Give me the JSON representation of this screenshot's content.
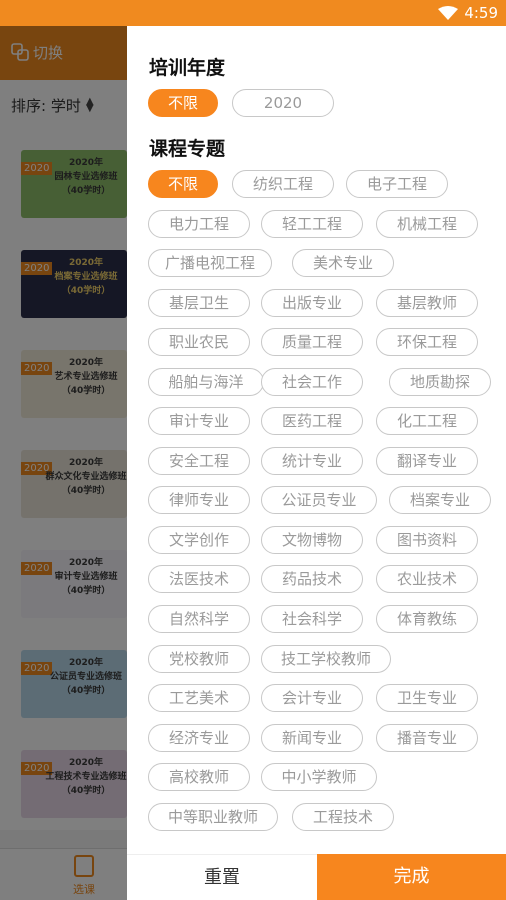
{
  "status_bar": {
    "time": "4:59"
  },
  "background_app": {
    "switch_label": "切换",
    "sort_label": "排序: 学时",
    "cards": [
      {
        "tag": "2020",
        "title": "2020年\n园林专业选修班\n（40学时）",
        "color": "#8fbf6a"
      },
      {
        "tag": "2020",
        "title": "2020年\n档案专业选修班\n（40学时）",
        "color": "#2a2f4a"
      },
      {
        "tag": "2020",
        "title": "2020年\n艺术专业选修班\n（40学时）",
        "color": "#f1ead8"
      },
      {
        "tag": "2020",
        "title": "2020年\n群众文化专业选修班\n（40学时）",
        "color": "#eae5d9"
      },
      {
        "tag": "2020",
        "title": "2020年\n审计专业选修班\n（40学时）",
        "color": "#f6f4fb"
      },
      {
        "tag": "2020",
        "title": "2020年\n公证员专业选修班\n（40学时）",
        "color": "#b9d8ea"
      },
      {
        "tag": "2020",
        "title": "2020年\n工程技术专业选修班\n（40学时）",
        "color": "#e8d9e8"
      }
    ],
    "bottom_tab": "选课"
  },
  "filter": {
    "year_title": "培训年度",
    "years": [
      "不限",
      "2020"
    ],
    "topic_title": "课程专题",
    "topics": [
      "不限",
      "纺织工程",
      "电子工程",
      "电力工程",
      "轻工工程",
      "机械工程",
      "广播电视工程",
      "美术专业",
      "基层卫生",
      "出版专业",
      "基层教师",
      "职业农民",
      "质量工程",
      "环保工程",
      "船舶与海洋",
      "社会工作",
      "地质勘探",
      "审计专业",
      "医药工程",
      "化工工程",
      "安全工程",
      "统计专业",
      "翻译专业",
      "律师专业",
      "公证员专业",
      "档案专业",
      "文学创作",
      "文物博物",
      "图书资料",
      "法医技术",
      "药品技术",
      "农业技术",
      "自然科学",
      "社会科学",
      "体育教练",
      "党校教师",
      "技工学校教师",
      "工艺美术",
      "会计专业",
      "卫生专业",
      "经济专业",
      "新闻专业",
      "播音专业",
      "高校教师",
      "中小学教师",
      "中等职业教师",
      "工程技术"
    ],
    "reset_label": "重置",
    "done_label": "完成"
  }
}
